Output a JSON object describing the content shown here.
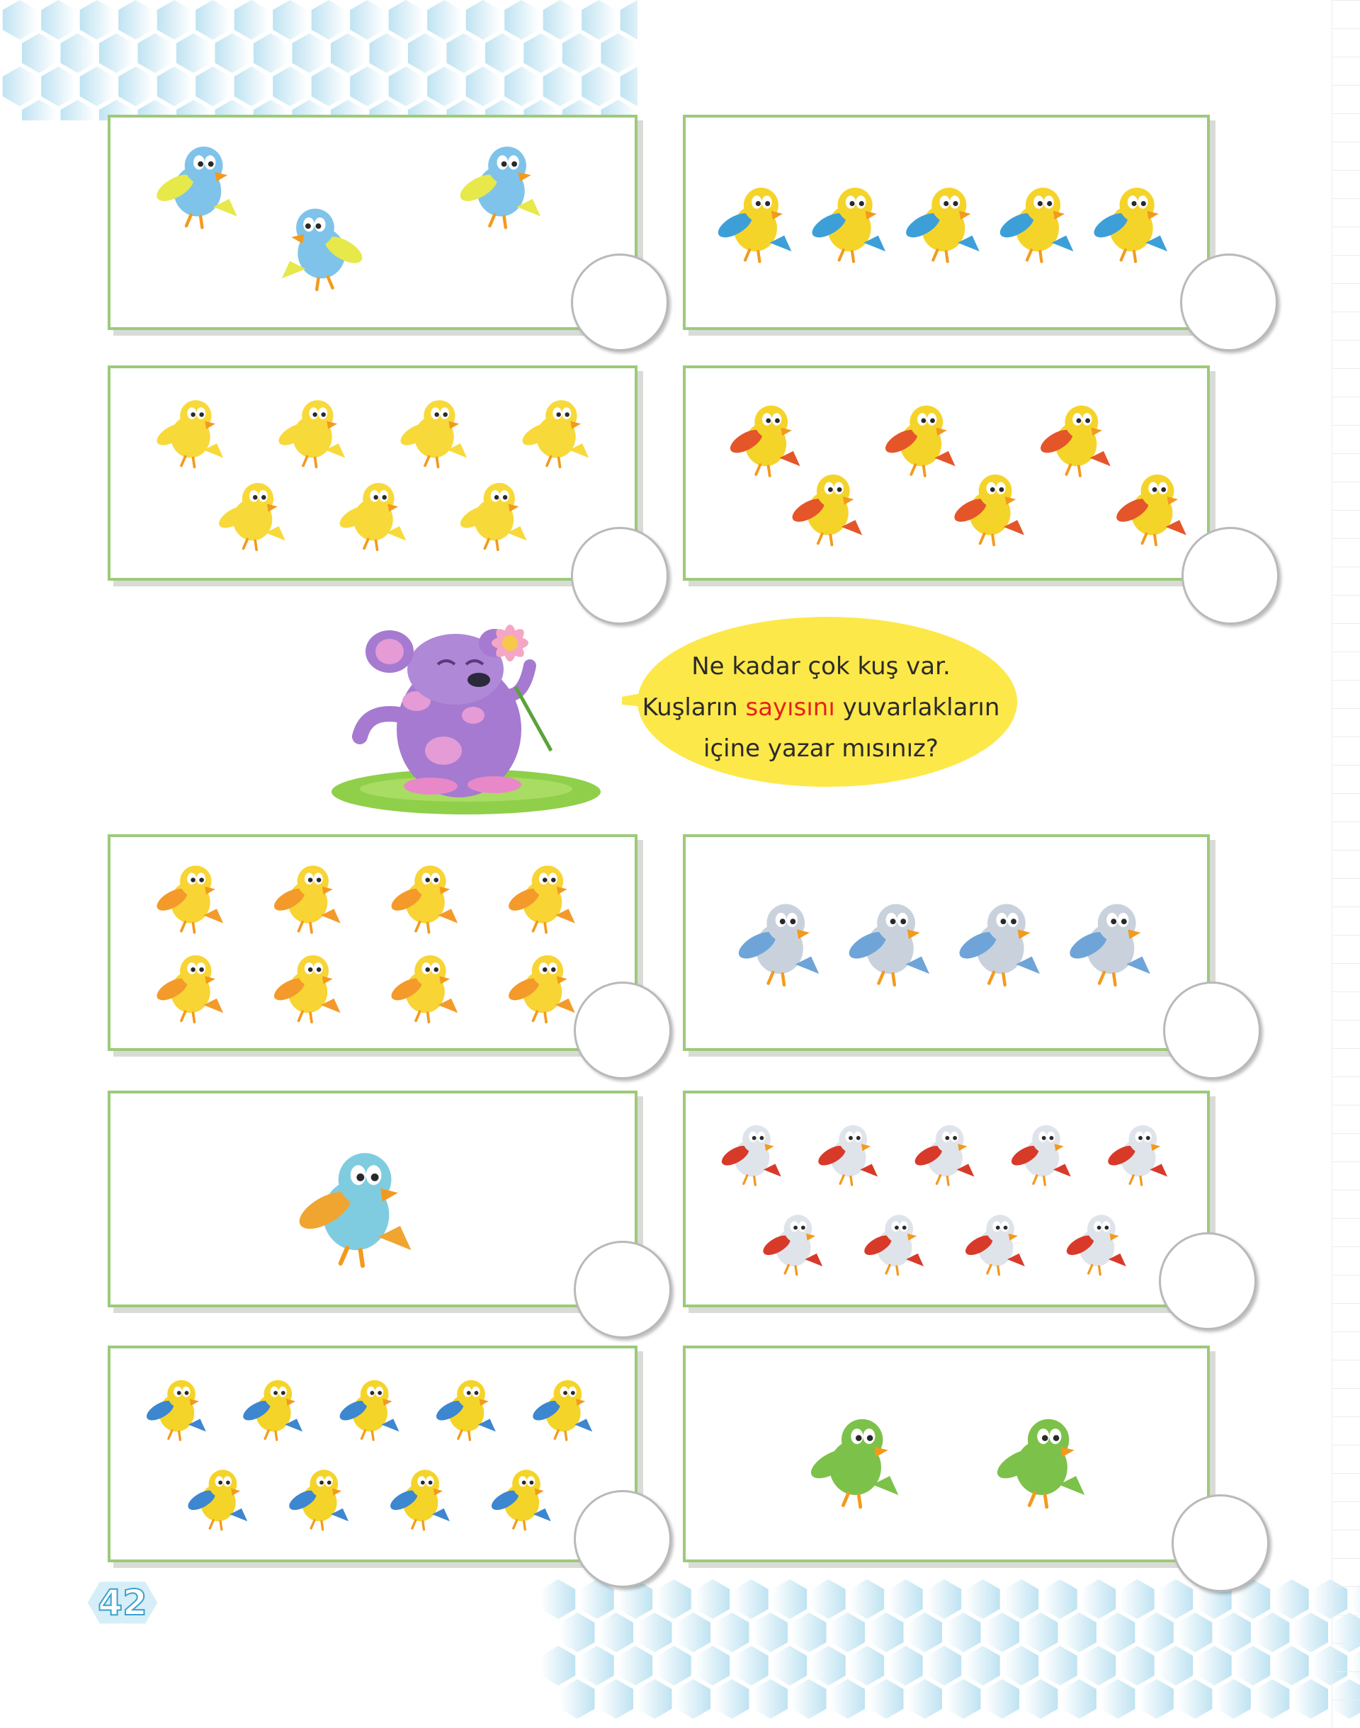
{
  "speech": {
    "line1": "Ne kadar çok kuş var.",
    "line2_before": "Kuşların ",
    "line2_highlight": "sayısını",
    "line2_after": " yuvarlakların",
    "line3": "içine yazar mısınız?"
  },
  "page_number": "42",
  "colors": {
    "panel_border": "#9dca7a",
    "bubble": "#fde84a",
    "highlight": "#e5211b",
    "hex": "#bfe3f2"
  },
  "panels": [
    {
      "id": "p1",
      "bird_count": 3,
      "bird_color": "#7fc3ea",
      "wing_color": "#e7e84a"
    },
    {
      "id": "p2",
      "bird_count": 5,
      "bird_color": "#f5d42a",
      "wing_color": "#3d9fd8"
    },
    {
      "id": "p3",
      "bird_count": 7,
      "bird_color": "#f7d93a",
      "wing_color": "#f7d93a"
    },
    {
      "id": "p4",
      "bird_count": 6,
      "bird_color": "#f5d42a",
      "wing_color": "#e5552a"
    },
    {
      "id": "p5",
      "bird_count": 8,
      "bird_color": "#f8d434",
      "wing_color": "#f49a2a"
    },
    {
      "id": "p6",
      "bird_count": 4,
      "bird_color": "#c9d2dc",
      "wing_color": "#6fa4d8"
    },
    {
      "id": "p7",
      "bird_count": 1,
      "bird_color": "#7fcce0",
      "wing_color": "#f0a530"
    },
    {
      "id": "p8",
      "bird_count": 9,
      "bird_color": "#dfe4ea",
      "wing_color": "#d83a2a"
    },
    {
      "id": "p9",
      "bird_count": 9,
      "bird_color": "#f5d42a",
      "wing_color": "#3d86d0"
    },
    {
      "id": "p10",
      "bird_count": 2,
      "bird_color": "#7cc24a",
      "wing_color": "#7cc24a"
    }
  ]
}
